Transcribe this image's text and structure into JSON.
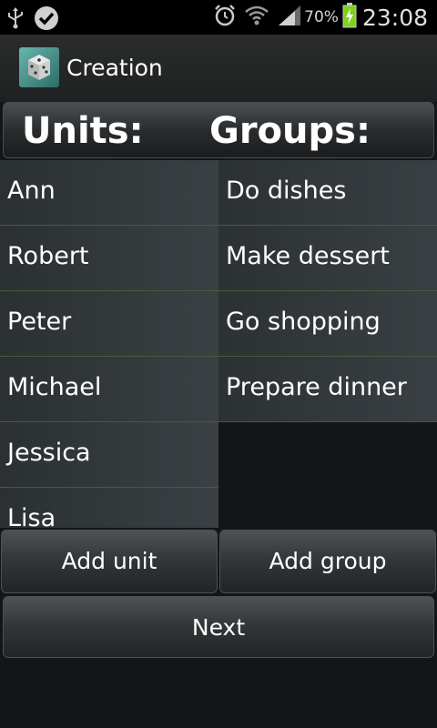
{
  "status_bar": {
    "icons": [
      "usb-icon",
      "check-badge-icon",
      "alarm-icon",
      "wifi-icon",
      "signal-icon",
      "battery-charging-icon"
    ],
    "battery_percent": "70%",
    "time": "23:08"
  },
  "action_bar": {
    "title": "Creation",
    "icon": "dice-app-icon"
  },
  "header": {
    "units_label": "Units:",
    "groups_label": "Groups:"
  },
  "units": [
    "Ann",
    "Robert",
    "Peter",
    "Michael",
    "Jessica",
    "Lisa"
  ],
  "groups": [
    "Do dishes",
    "Make dessert",
    "Go shopping",
    "Prepare dinner"
  ],
  "buttons": {
    "add_unit": "Add unit",
    "add_group": "Add group",
    "next": "Next"
  },
  "colors": {
    "status_bar_bg": "#000000",
    "battery_fill": "#7fd11d",
    "app_icon_bg": "#4f9e96"
  }
}
